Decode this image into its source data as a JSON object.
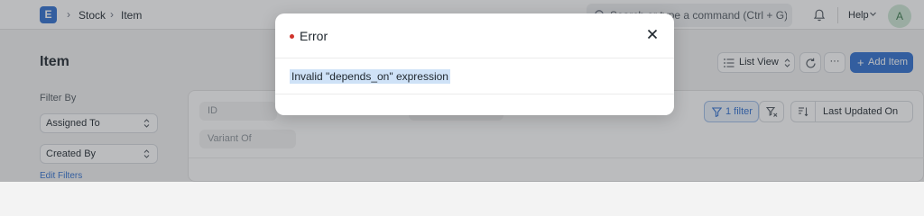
{
  "navbar": {
    "logo_letter": "E",
    "breadcrumbs": [
      "Stock",
      "Item"
    ],
    "search_placeholder": "Search or type a command (Ctrl + G)",
    "help_label": "Help",
    "avatar_initial": "A"
  },
  "page": {
    "title": "Item",
    "list_view_label": "List View",
    "more_label": "···",
    "add_label": "Add Item",
    "add_plus": "+"
  },
  "sidebar": {
    "filter_by_label": "Filter By",
    "selects": [
      {
        "label": "Assigned To"
      },
      {
        "label": "Created By"
      }
    ],
    "edit_filters_label": "Edit Filters"
  },
  "list": {
    "standard_filters": [
      {
        "placeholder": "ID"
      },
      {
        "placeholder": "Variant Of"
      }
    ],
    "filter_button_label": "1 filter",
    "sort_label": "Last Updated On"
  },
  "modal": {
    "title": "Error",
    "message": "Invalid \"depends_on\" expression",
    "indicator_color": "#d0342c"
  },
  "colors": {
    "primary": "#2f6fd0",
    "error": "#d0342c",
    "selection": "#cfe2f7"
  },
  "icons": [
    "logo-icon",
    "chevron-right-icon",
    "search-icon",
    "bell-icon",
    "chevron-down-icon",
    "list-icon",
    "refresh-icon",
    "filter-icon",
    "filter-clear-icon",
    "sort-icon",
    "close-icon"
  ]
}
